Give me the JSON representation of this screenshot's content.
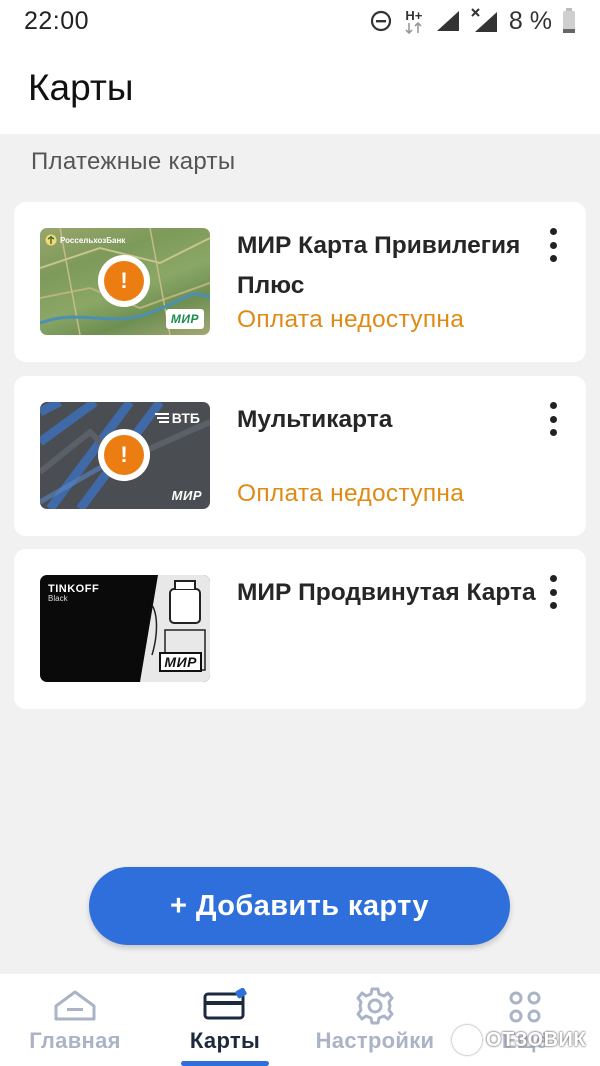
{
  "status_bar": {
    "time": "22:00",
    "network_type": "H+",
    "battery_text": "8 %",
    "icons": [
      "dnd-icon",
      "data-arrows-icon",
      "signal-icon",
      "signal-no-service-icon",
      "battery-icon"
    ]
  },
  "header": {
    "title": "Карты"
  },
  "section": {
    "title": "Платежные карты"
  },
  "cards": [
    {
      "name": "МИР Карта Привилегия Плюс",
      "status": "Оплата недоступна",
      "bank_logo_text": "РоссельхозБанк",
      "network": "МИР",
      "icon": "warning-icon"
    },
    {
      "name": "Мультикарта",
      "status": "Оплата недоступна",
      "bank_logo_text": "ВТБ",
      "network": "МИР",
      "icon": "warning-icon"
    },
    {
      "name": "МИР Продвинутая Карта",
      "status": "",
      "bank_logo_text": "TINKOFF",
      "bank_logo_sub": "Black",
      "network": "МИР"
    }
  ],
  "add_button": {
    "label": "+ Добавить карту"
  },
  "bottom_nav": {
    "items": [
      {
        "label": "Главная",
        "icon": "home-icon",
        "active": false
      },
      {
        "label": "Карты",
        "icon": "cards-icon",
        "active": true
      },
      {
        "label": "Настройки",
        "icon": "gear-icon",
        "active": false
      },
      {
        "label": "Ещё",
        "icon": "apps-grid-icon",
        "active": false
      }
    ]
  },
  "watermark": {
    "text": "ОТЗОВИК"
  },
  "colors": {
    "accent": "#2f6fdc",
    "warning": "#e08a14",
    "nav_inactive": "#aab4c6",
    "nav_active": "#1d2a3d",
    "background": "#f1f1f1"
  }
}
